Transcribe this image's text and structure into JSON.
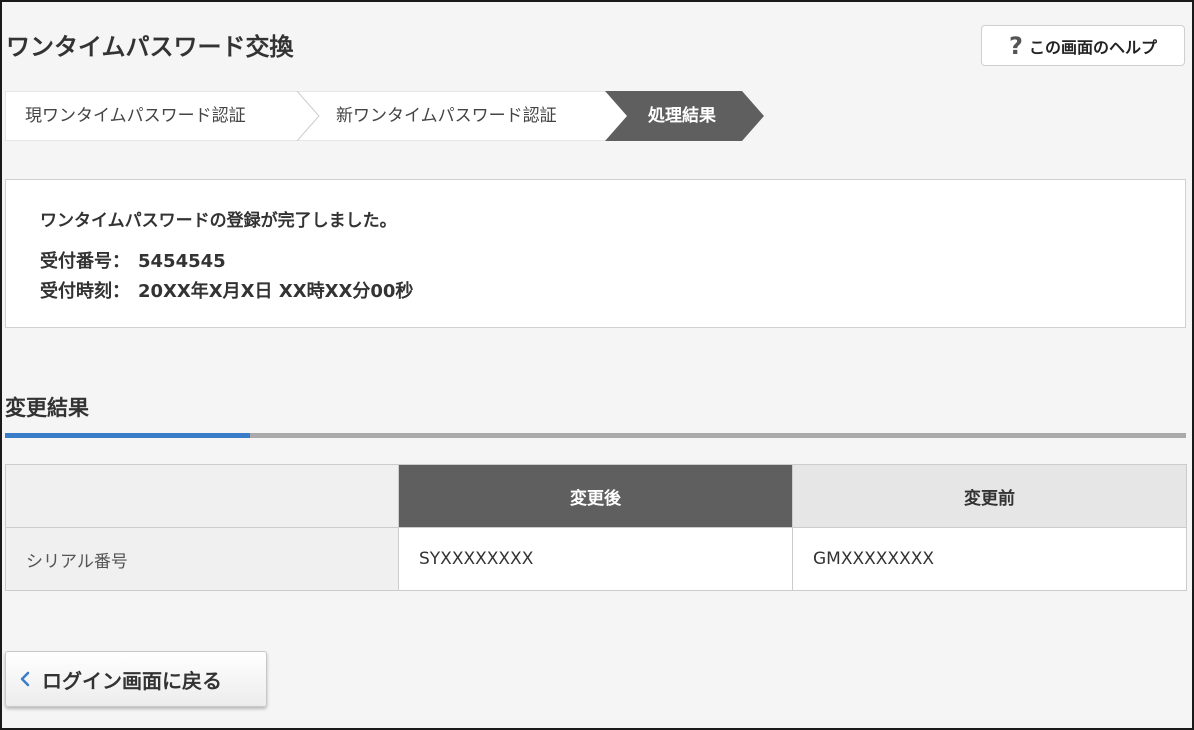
{
  "page": {
    "title": "ワンタイムパスワード交換"
  },
  "help_button": {
    "icon": "question-icon",
    "icon_glyph": "?",
    "label": "この画面のヘルプ"
  },
  "steps": [
    {
      "label": "現ワンタイムパスワード認証",
      "state": "done"
    },
    {
      "label": "新ワンタイムパスワード認証",
      "state": "done"
    },
    {
      "label": "処理結果",
      "state": "current"
    }
  ],
  "completion": {
    "message": "ワンタイムパスワードの登録が完了しました。",
    "receipt_number_label": "受付番号：",
    "receipt_number": "5454545",
    "receipt_time_label": "受付時刻：",
    "receipt_time": "20XX年X月X日 XX時XX分00秒"
  },
  "result_section": {
    "title": "変更結果",
    "table": {
      "headers": [
        "",
        "変更後",
        "変更前"
      ],
      "rows": [
        {
          "label": "シリアル番号",
          "after": "SYXXXXXXXX",
          "before": "GMXXXXXXXX"
        }
      ]
    }
  },
  "back_button": {
    "icon": "chevron-left-icon",
    "label": "ログイン画面に戻る"
  },
  "colors": {
    "accent_blue": "#3b7cc9",
    "active_step": "#5f5f5f",
    "page_background": "#f5f5f5"
  }
}
